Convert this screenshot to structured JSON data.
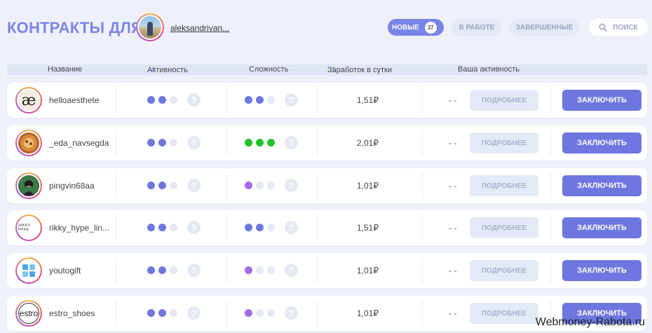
{
  "header": {
    "title": "КОНТРАКТЫ ДЛЯ",
    "username": "aleksandrivan...",
    "tabs": [
      {
        "label": "НОВЫЕ",
        "badge": "37",
        "active": true
      },
      {
        "label": "В РАБОТЕ",
        "active": false
      },
      {
        "label": "ЗАВЕРШЕННЫЕ",
        "active": false
      }
    ],
    "search_label": "ПОИСК",
    "search_icon": "search-icon"
  },
  "columns": {
    "name": "Название",
    "activity": "Активность",
    "difficulty": "Сложность",
    "earnings": "Заработок в сутки",
    "your_activity": "Ваша активность"
  },
  "colors": {
    "accent": "#6e77e0",
    "dot_empty": "#e4e8f3",
    "green": "#22c22a",
    "purple": "#a26be6"
  },
  "rows": [
    {
      "name": "helloaesthete",
      "avatar_text": "æ",
      "avatar_bg": "#f3ede4",
      "activity_level": 2,
      "difficulty": {
        "level": 2,
        "color": "#6e77e0"
      },
      "earn": "1,51₽",
      "your_activity": "- -",
      "more_label": "ПОДРОБНЕЕ",
      "sign_label": "ЗАКЛЮЧИТЬ"
    },
    {
      "name": "_eda_navsegda",
      "avatar_text": "",
      "avatar_bg": "#b3612b",
      "activity_level": 2,
      "difficulty": {
        "level": 3,
        "color": "#22c22a"
      },
      "earn": "2,01₽",
      "your_activity": "- -",
      "more_label": "ПОДРОБНЕЕ",
      "sign_label": "ЗАКЛЮЧИТЬ"
    },
    {
      "name": "pingvin68aa",
      "avatar_text": "",
      "avatar_bg": "#2f5a3a",
      "activity_level": 2,
      "difficulty": {
        "level": 1,
        "color": "#a26be6"
      },
      "earn": "1,01₽",
      "your_activity": "- -",
      "more_label": "ПОДРОБНЕЕ",
      "sign_label": "ЗАКЛЮЧИТЬ"
    },
    {
      "name": "rikky_hype_lin...",
      "avatar_text": "RIKKY HYPE",
      "avatar_bg": "#ffffff",
      "activity_level": 2,
      "difficulty": {
        "level": 2,
        "color": "#6e77e0"
      },
      "earn": "1,51₽",
      "your_activity": "- -",
      "more_label": "ПОДРОБНЕЕ",
      "sign_label": "ЗАКЛЮЧИТЬ"
    },
    {
      "name": "youtogift",
      "avatar_text": "",
      "avatar_bg": "#ffffff",
      "activity_level": 2,
      "difficulty": {
        "level": 1,
        "color": "#a26be6"
      },
      "earn": "1,01₽",
      "your_activity": "- -",
      "more_label": "ПОДРОБНЕЕ",
      "sign_label": "ЗАКЛЮЧИТЬ"
    },
    {
      "name": "estro_shoes",
      "avatar_text": "estro",
      "avatar_bg": "#ffffff",
      "activity_level": 2,
      "difficulty": {
        "level": 1,
        "color": "#a26be6"
      },
      "earn": "1,01₽",
      "your_activity": "- -",
      "more_label": "ПОДРОБНЕЕ",
      "sign_label": "ЗАКЛЮЧИТЬ"
    }
  ],
  "watermark": "Webmoney-Rabota.ru"
}
